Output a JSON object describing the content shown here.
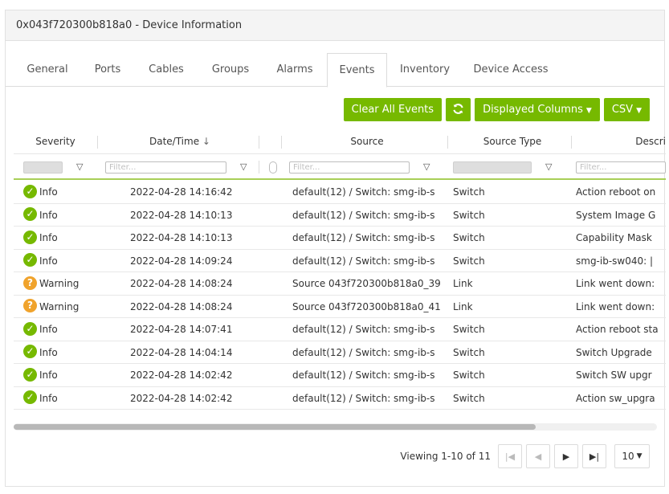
{
  "header": {
    "title": "0x043f720300b818a0 - Device Information"
  },
  "tabs": [
    {
      "label": "General"
    },
    {
      "label": "Ports"
    },
    {
      "label": "Cables"
    },
    {
      "label": "Groups"
    },
    {
      "label": "Alarms"
    },
    {
      "label": "Events"
    },
    {
      "label": "Inventory"
    },
    {
      "label": "Device Access"
    }
  ],
  "active_tab": "Events",
  "toolbar": {
    "clear_label": "Clear All Events",
    "refresh_icon": "refresh-icon",
    "columns_label": "Displayed Columns",
    "csv_label": "CSV"
  },
  "columns": {
    "severity": "Severity",
    "datetime": "Date/Time",
    "sort_indicator": "↓",
    "source": "Source",
    "source_type": "Source Type",
    "description": "Descri"
  },
  "filters": {
    "placeholder": "Filter..."
  },
  "colors": {
    "accent": "#76b900",
    "warning": "#f0a32c"
  },
  "rows": [
    {
      "severity": "Info",
      "datetime": "2022-04-28 14:16:42",
      "source": "default(12) / Switch: smg-ib-s",
      "source_type": "Switch",
      "description": "Action reboot on"
    },
    {
      "severity": "Info",
      "datetime": "2022-04-28 14:10:13",
      "source": "default(12) / Switch: smg-ib-s",
      "source_type": "Switch",
      "description": "System Image G"
    },
    {
      "severity": "Info",
      "datetime": "2022-04-28 14:10:13",
      "source": "default(12) / Switch: smg-ib-s",
      "source_type": "Switch",
      "description": "Capability Mask"
    },
    {
      "severity": "Info",
      "datetime": "2022-04-28 14:09:24",
      "source": "default(12) / Switch: smg-ib-s",
      "source_type": "Switch",
      "description": "smg-ib-sw040: |"
    },
    {
      "severity": "Warning",
      "datetime": "2022-04-28 14:08:24",
      "source": "Source 043f720300b818a0_39",
      "source_type": "Link",
      "description": "Link went down:"
    },
    {
      "severity": "Warning",
      "datetime": "2022-04-28 14:08:24",
      "source": "Source 043f720300b818a0_41",
      "source_type": "Link",
      "description": "Link went down:"
    },
    {
      "severity": "Info",
      "datetime": "2022-04-28 14:07:41",
      "source": "default(12) / Switch: smg-ib-s",
      "source_type": "Switch",
      "description": "Action reboot sta"
    },
    {
      "severity": "Info",
      "datetime": "2022-04-28 14:04:14",
      "source": "default(12) / Switch: smg-ib-s",
      "source_type": "Switch",
      "description": "Switch Upgrade"
    },
    {
      "severity": "Info",
      "datetime": "2022-04-28 14:02:42",
      "source": "default(12) / Switch: smg-ib-s",
      "source_type": "Switch",
      "description": "Switch SW upgr"
    },
    {
      "severity": "Info",
      "datetime": "2022-04-28 14:02:42",
      "source": "default(12) / Switch: smg-ib-s",
      "source_type": "Switch",
      "description": "Action sw_upgra"
    }
  ],
  "pager": {
    "viewing_prefix": "Viewing ",
    "viewing_range": "1-10",
    "viewing_of": " of ",
    "viewing_total": "11",
    "page_size": "10"
  }
}
